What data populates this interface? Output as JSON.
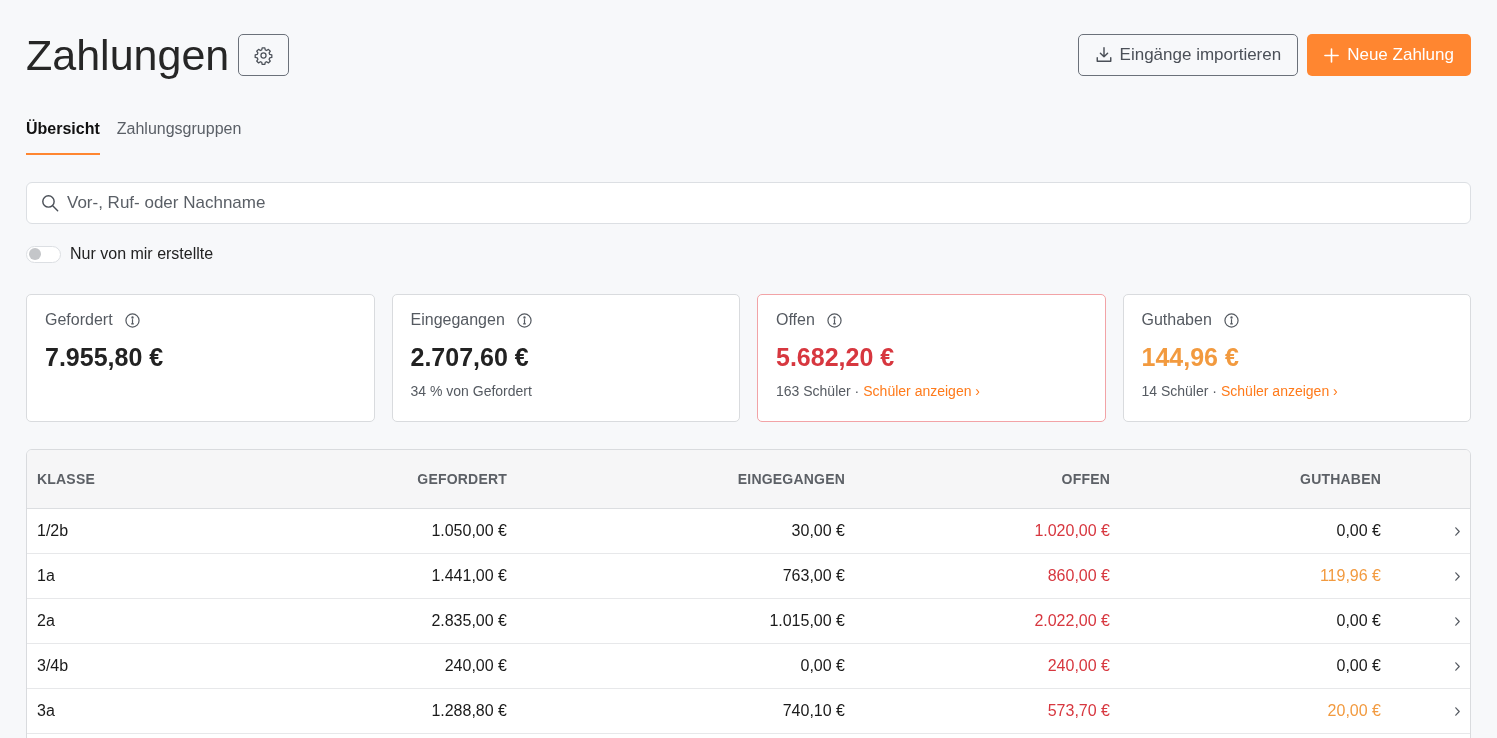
{
  "page": {
    "title": "Zahlungen"
  },
  "actions": [
    {
      "kind": "import",
      "label": "Eingänge importieren"
    },
    {
      "kind": "create",
      "label": "Neue Zahlung"
    }
  ],
  "tabs": [
    {
      "label": "Übersicht",
      "selected": true
    },
    {
      "label": "Zahlungsgruppen",
      "selected": false
    }
  ],
  "search": {
    "placeholder": "Vor-, Ruf- oder Nachname"
  },
  "filter_toggle": {
    "label": "Nur von mir erstellte",
    "on": false
  },
  "summary_cards": [
    {
      "label": "Gefordert",
      "value": "7.955,80 €",
      "color": "#222222",
      "highlighted": false
    },
    {
      "label": "Eingegangen",
      "value": "2.707,60 €",
      "color": "#222222",
      "highlighted": false,
      "note": "34 % von Gefordert"
    },
    {
      "label": "Offen",
      "value": "5.682,20 €",
      "color": "#d7373f",
      "highlighted": true,
      "note": "163 Schüler ·",
      "link": "Schüler anzeigen ›"
    },
    {
      "label": "Guthaben",
      "value": "144,96 €",
      "color": "#f29a3f",
      "highlighted": false,
      "note": "14 Schüler ·",
      "link": "Schüler anzeigen ›"
    }
  ],
  "table": {
    "columns": [
      "KLASSE",
      "GEFORDERT",
      "EINGEGANGEN",
      "OFFEN",
      "GUTHABEN"
    ],
    "rows": [
      {
        "cells": [
          {
            "text": "1/2b"
          },
          {
            "text": "1.050,00 €"
          },
          {
            "text": "30,00 €"
          },
          {
            "text": "1.020,00 €",
            "color": "#d7373f"
          },
          {
            "text": "0,00 €"
          }
        ]
      },
      {
        "cells": [
          {
            "text": "1a"
          },
          {
            "text": "1.441,00 €"
          },
          {
            "text": "763,00 €"
          },
          {
            "text": "860,00 €",
            "color": "#d7373f"
          },
          {
            "text": "119,96 €",
            "color": "#f29a3f"
          }
        ]
      },
      {
        "cells": [
          {
            "text": "2a"
          },
          {
            "text": "2.835,00 €"
          },
          {
            "text": "1.015,00 €"
          },
          {
            "text": "2.022,00 €",
            "color": "#d7373f"
          },
          {
            "text": "0,00 €"
          }
        ]
      },
      {
        "cells": [
          {
            "text": "3/4b"
          },
          {
            "text": "240,00 €"
          },
          {
            "text": "0,00 €"
          },
          {
            "text": "240,00 €",
            "color": "#d7373f"
          },
          {
            "text": "0,00 €"
          }
        ]
      },
      {
        "cells": [
          {
            "text": "3a"
          },
          {
            "text": "1.288,80 €"
          },
          {
            "text": "740,10 €"
          },
          {
            "text": "573,70 €",
            "color": "#d7373f"
          },
          {
            "text": "20,00 €",
            "color": "#f29a3f"
          }
        ]
      }
    ]
  }
}
